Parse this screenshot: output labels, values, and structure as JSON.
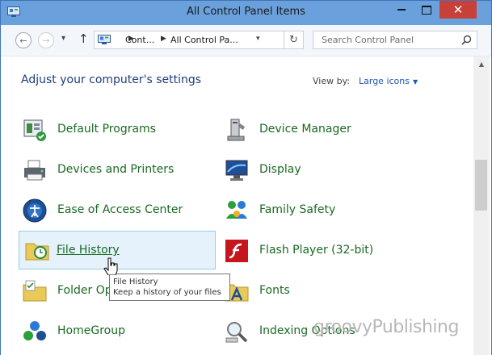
{
  "window": {
    "title": "All Control Panel Items",
    "close_glyph": "✕"
  },
  "nav": {
    "breadcrumb": [
      "Cont...",
      "All Control Pa..."
    ],
    "search_placeholder": "Search Control Panel"
  },
  "header": {
    "heading": "Adjust your computer's settings",
    "view_by_label": "View by:",
    "view_by_value": "Large icons"
  },
  "items": [
    {
      "label": "Default Programs"
    },
    {
      "label": "Device Manager"
    },
    {
      "label": "Devices and Printers"
    },
    {
      "label": "Display"
    },
    {
      "label": "Ease of Access Center"
    },
    {
      "label": "Family Safety"
    },
    {
      "label": "File History"
    },
    {
      "label": "Flash Player (32-bit)"
    },
    {
      "label": "Folder Options"
    },
    {
      "label": "Fonts"
    },
    {
      "label": "HomeGroup"
    },
    {
      "label": "Indexing Options"
    }
  ],
  "tooltip": {
    "title": "File History",
    "text": "Keep a history of your files"
  },
  "watermark": "groovyPublishing",
  "colors": {
    "titlebar": "#6aa0dc",
    "link_green": "#196a22",
    "heading_blue": "#1e3d7a",
    "close_red": "#c7413a"
  }
}
